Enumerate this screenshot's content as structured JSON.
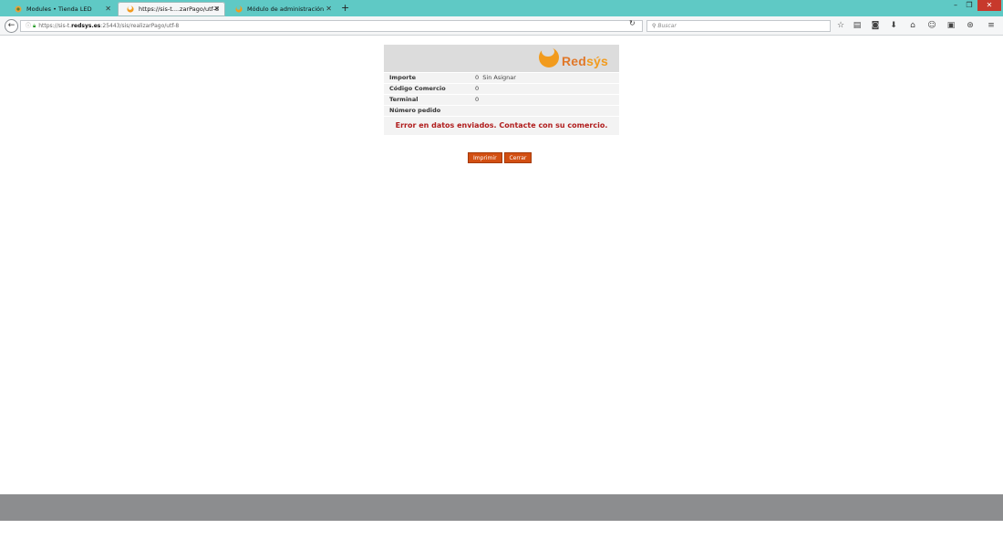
{
  "browser": {
    "tabs": [
      {
        "title": "Modules • Tienda LED",
        "active": false
      },
      {
        "title": "https://sis-t....zarPago/utf-8",
        "active": true
      },
      {
        "title": "Módulo de administración",
        "active": false
      }
    ],
    "url": {
      "prefix": "https://sis-t.",
      "host": "redsys.es",
      "rest": ":25443/sis/realizarPago/utf-8"
    },
    "search_placeholder": "Buscar",
    "icons": [
      "star-icon",
      "reading-list-icon",
      "pocket-icon",
      "download-icon",
      "home-icon",
      "chat-icon",
      "screenshot-icon",
      "extension-icon",
      "menu-icon"
    ]
  },
  "logo": {
    "main": "Red",
    "accent": "sýs"
  },
  "details": [
    {
      "label": "Importe",
      "value": "0  Sin Asignar"
    },
    {
      "label": "Código Comercio",
      "value": "0"
    },
    {
      "label": "Terminal",
      "value": "0"
    },
    {
      "label": "Número pedido",
      "value": ""
    }
  ],
  "error_message": "Error en datos enviados. Contacte con su comercio.",
  "buttons": {
    "print": "Imprimir",
    "close": "Cerrar"
  },
  "colors": {
    "tabbar": "#5fc9c5",
    "button": "#d24f12",
    "error": "#b01c1c",
    "brand": "#f29b1d"
  }
}
